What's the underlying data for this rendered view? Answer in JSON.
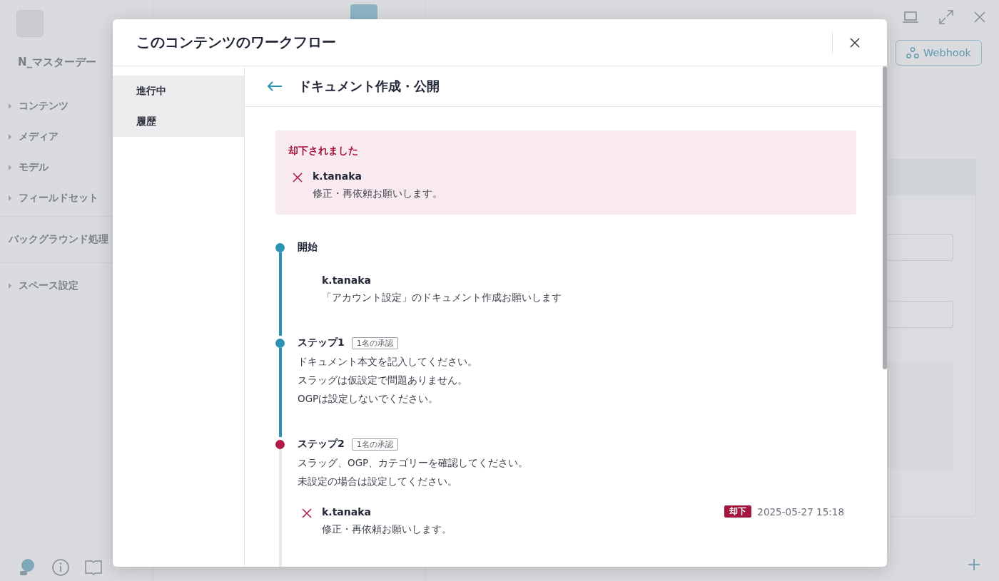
{
  "sidebar": {
    "space_name": "N_マスターデー",
    "items": [
      {
        "label": "コンテンツ",
        "kind": "tree"
      },
      {
        "label": "メディア",
        "kind": "tree"
      },
      {
        "label": "モデル",
        "kind": "tree"
      },
      {
        "label": "フィールドセット",
        "kind": "tree"
      },
      {
        "label": "バックグラウンド処理",
        "kind": "plain"
      },
      {
        "label": "スペース設定",
        "kind": "tree"
      }
    ]
  },
  "toolbar": {
    "webhook_button": "Webhook"
  },
  "dialog": {
    "title": "このコンテンツのワークフロー",
    "tabs": [
      {
        "label": "進行中"
      },
      {
        "label": "履歴"
      }
    ],
    "workflow_title": "ドキュメント作成・公開",
    "alert": {
      "title": "却下されました",
      "user": "k.tanaka",
      "comment": "修正・再依頼お願いします。"
    },
    "steps": [
      {
        "kind": "start",
        "title": "開始",
        "rejected": false,
        "comments": [
          {
            "user": "k.tanaka",
            "comment": "「アカウント設定」のドキュメント作成お願いします",
            "rejected": false
          }
        ]
      },
      {
        "kind": "step",
        "title": "ステップ1",
        "badge": "1名の承認",
        "rejected": false,
        "lines": [
          "ドキュメント本文を記入してください。",
          "スラッグは仮設定で問題ありません。",
          "OGPは設定しないでください。"
        ]
      },
      {
        "kind": "step",
        "title": "ステップ2",
        "badge": "1名の承認",
        "rejected": true,
        "lines": [
          "スラッグ、OGP、カテゴリーを確認してください。",
          "未設定の場合は設定してください。"
        ],
        "comments": [
          {
            "user": "k.tanaka",
            "comment": "修正・再依頼お願いします。",
            "rejected": true,
            "tag": "却下",
            "time": "2025-05-27 15:18"
          }
        ]
      }
    ]
  }
}
